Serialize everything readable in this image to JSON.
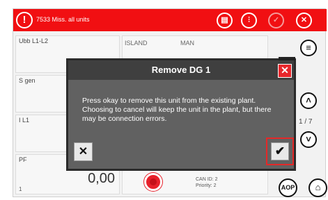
{
  "topbar": {
    "alarm_icon": "!",
    "alarm_text": "7533 Miss. all units",
    "buttons": [
      {
        "icon": "log-icon",
        "glyph": "▤"
      },
      {
        "icon": "settings-sliders-icon",
        "glyph": "⫶"
      },
      {
        "icon": "check-icon",
        "glyph": "✓"
      },
      {
        "icon": "close-icon",
        "glyph": "✕"
      }
    ],
    "color": "#f10f12"
  },
  "grid": {
    "cells": [
      {
        "label": "Ubb L1-L2"
      },
      {
        "label": "S gen"
      },
      {
        "label": "I L1"
      },
      {
        "label": "PF",
        "value": "0,00",
        "foot": "1"
      }
    ],
    "island": "ISLAND",
    "man": "MAN"
  },
  "right_panel": {
    "menu_glyph": "≡",
    "up_glyph": "˄",
    "down_glyph": "˅",
    "pager": "1 / 7"
  },
  "footer": {
    "can_id": "CAN ID: 2",
    "priority": "Priority: 2",
    "aop_label": "AOP",
    "home_glyph": "⌂"
  },
  "dialog": {
    "title": "Remove DG 1",
    "close_glyph": "✕",
    "body": "Press okay to remove this unit from the existing plant. Choosing to cancel will keep the unit in the plant, but there may be connection errors.",
    "cancel_glyph": "✕",
    "ok_glyph": "✔",
    "accent": "#e52828"
  }
}
